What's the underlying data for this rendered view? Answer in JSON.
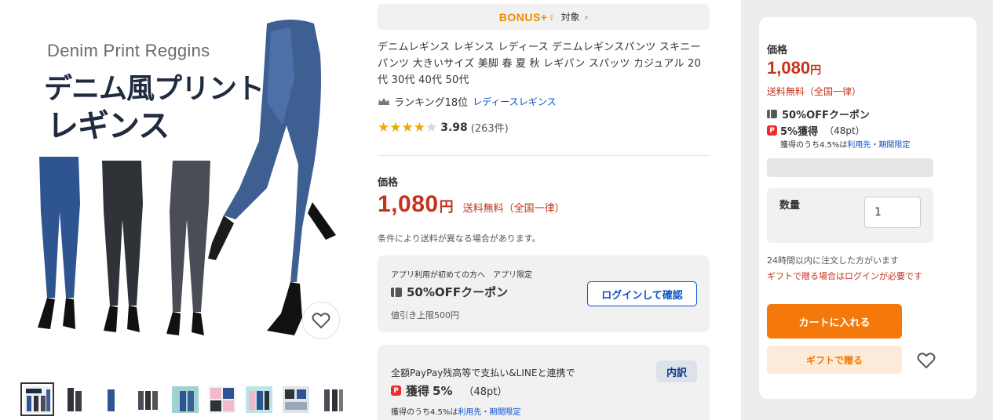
{
  "image": {
    "title_en": "Denim Print Reggins",
    "title_jp_line1": "デニム風プリント",
    "title_jp_line2": "レギンス",
    "thumbnail_count": 9
  },
  "bonus": {
    "logo": "BONUS+♀",
    "target": "対象",
    "chevron": "›"
  },
  "product": {
    "title": "デニムレギンス レギンス レディース デニムレギンスパンツ スキニーパンツ 大きいサイズ 美脚 春 夏 秋 レギパン スパッツ カジュアル 20代 30代 40代 50代",
    "ranking_text": "ランキング18位",
    "ranking_link": "レディースレギンス",
    "rating_score": "3.98",
    "rating_value": 3.98,
    "rating_count": "(263件)"
  },
  "price": {
    "label": "価格",
    "amount": "1,080",
    "yen": "円",
    "shipping": "送料無料（全国一律）",
    "shipping_note": "条件により送料が異なる場合があります。"
  },
  "coupon": {
    "sub": "アプリ利用が初めての方へ　アプリ限定",
    "title": "50%OFFクーポン",
    "limit": "値引き上限500円",
    "login_button": "ログインして確認"
  },
  "paypay": {
    "sub": "全額PayPay残高等で支払い&LINEと連携で",
    "detail_button": "内訳",
    "earn_label": "獲得",
    "earn_rate": "5%",
    "earn_points": "（48pt）",
    "note_prefix": "獲得のうち4.5%は",
    "note_link": "利用先・期間限定"
  },
  "side": {
    "price_label": "価格",
    "price_amount": "1,080",
    "price_yen": "円",
    "shipping": "送料無料（全国一律）",
    "coupon": "50%OFFクーポン",
    "earn_label": "5%獲得",
    "earn_points": "（48pt）",
    "earn_note_prefix": "獲得のうち4.5%は",
    "earn_note_link": "利用先・期間限定",
    "qty_label": "数量",
    "qty_value": "1",
    "note_orders": "24時間以内に注文した方がいます",
    "note_gift": "ギフトで贈る場合はログインが必要です",
    "cart_button": "カートに入れる",
    "gift_button": "ギフトで贈る"
  },
  "colors": {
    "price_red": "#c5331d",
    "link_blue": "#0a50c8",
    "cart_orange": "#f5780a",
    "star_gold": "#f0a800",
    "bonus_orange": "#f28a00"
  }
}
